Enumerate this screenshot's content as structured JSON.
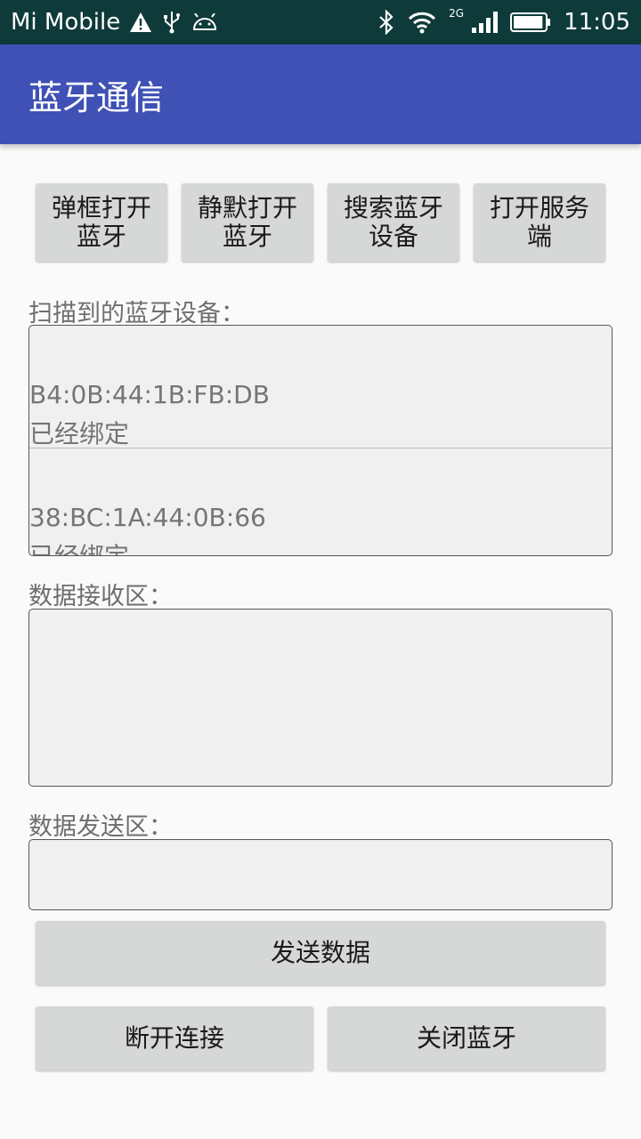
{
  "status_bar": {
    "carrier": "Mi Mobile",
    "network_type": "2G",
    "time": "11:05",
    "icons": [
      "warning-icon",
      "usb-icon",
      "android-icon",
      "bluetooth-icon",
      "wifi-icon",
      "signal-icon",
      "battery-icon"
    ],
    "battery_level": 0.95
  },
  "app_bar": {
    "title": "蓝牙通信"
  },
  "top_buttons": [
    {
      "label": "弹框打开蓝牙"
    },
    {
      "label": "静默打开蓝牙"
    },
    {
      "label": "搜索蓝牙设备"
    },
    {
      "label": "打开服务端"
    }
  ],
  "device_list": {
    "label": "扫描到的蓝牙设备：",
    "items": [
      {
        "address": "B4:0B:44:1B:FB:DB",
        "status": "已经绑定"
      },
      {
        "address": "38:BC:1A:44:0B:66",
        "status": "已经绑定"
      }
    ]
  },
  "receive_area": {
    "label": "数据接收区：",
    "content": ""
  },
  "send_area": {
    "label": "数据发送区：",
    "value": ""
  },
  "send_button": {
    "label": "发送数据"
  },
  "bottom_buttons": {
    "disconnect": "断开连接",
    "close_bluetooth": "关闭蓝牙"
  },
  "colors": {
    "status_bar": "#0e3b3a",
    "app_bar": "#3f51b5",
    "button": "#d6d7d7",
    "background": "#fafafa"
  }
}
